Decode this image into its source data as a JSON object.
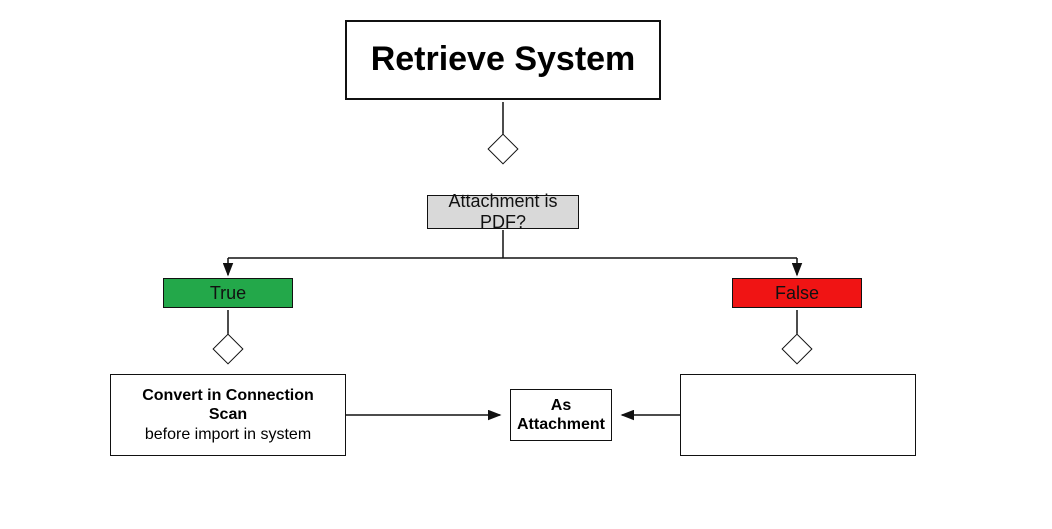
{
  "nodes": {
    "retrieve": "Retrieve System",
    "decision": "Attachment is PDF?",
    "true": "True",
    "false": "False",
    "convert_label_line1": "Convert in Connection Scan",
    "convert_label_line2": "before import in system",
    "as_attach_line1": "As",
    "as_attach_line2": "Attachment"
  },
  "chart_data": {
    "type": "flowchart",
    "nodes": [
      {
        "id": "retrieve",
        "label": "Retrieve System",
        "kind": "process"
      },
      {
        "id": "decision",
        "label": "Attachment is PDF?",
        "kind": "decision"
      },
      {
        "id": "true",
        "label": "True",
        "kind": "branch-label",
        "color": "green"
      },
      {
        "id": "false",
        "label": "False",
        "kind": "branch-label",
        "color": "red"
      },
      {
        "id": "convert",
        "label": "Convert in Connection Scan before import in system",
        "kind": "process"
      },
      {
        "id": "as_attach",
        "label": "As Attachment",
        "kind": "process"
      }
    ],
    "edges": [
      {
        "from": "retrieve",
        "to": "decision"
      },
      {
        "from": "decision",
        "to": "true"
      },
      {
        "from": "decision",
        "to": "false"
      },
      {
        "from": "true",
        "to": "convert"
      },
      {
        "from": "false",
        "to": "as_attach"
      },
      {
        "from": "convert",
        "to": "as_attach"
      }
    ]
  }
}
